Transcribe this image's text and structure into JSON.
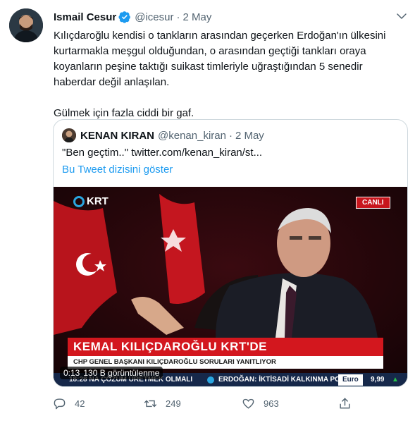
{
  "tweet": {
    "author_name": "Ismail Cesur",
    "author_handle": "@icesur",
    "separator": "·",
    "date": "2 May",
    "text_paragraph_1": "Kılıçdaroğlu kendisi o tankların arasından geçerken Erdoğan'ın ülkesini kurtarmakla meşgul olduğundan, o arasından geçtiği tankları oraya koyanların peşine taktığı suikast timleriyle uğraştığından 5 senedir haberdar değil anlaşılan.",
    "text_paragraph_2": "Gülmek için fazla ciddi bir gaf."
  },
  "quoted_tweet": {
    "author_name": "KENAN KIRAN",
    "author_handle": "@kenan_kiran",
    "separator": "·",
    "date": "2 May",
    "text": "\"Ben geçtim..\"  twitter.com/kenan_kiran/st...",
    "thread_link": "Bu Tweet dizisini göster",
    "video": {
      "channel_logo": "KRT",
      "live_badge": "CANLI",
      "lower_third_title": "KEMAL KILIÇDAROĞLU KRT'DE",
      "lower_third_subtitle": "CHP GENEL BAŞKANI KILIÇDAROĞLU SORULARI YANITLIYOR",
      "ticker_left": "18:28 NA ÇÖZÜM ÜRETMEK OLMALI",
      "ticker_right": "ERDOĞAN: İKTİSADİ KALKINMA PC",
      "ticker_euro_label": "Euro",
      "ticker_euro_value": "9,99",
      "ticker_euro_arrow": "▲",
      "elapsed_time": "0:13",
      "views": "130 B görüntülenme"
    }
  },
  "actions": {
    "reply_count": "42",
    "retweet_count": "249",
    "like_count": "963"
  },
  "icons": {
    "verified": "verified-badge-icon",
    "caret": "chevron-down-icon",
    "reply": "reply-icon",
    "retweet": "retweet-icon",
    "like": "heart-icon",
    "share": "share-icon"
  },
  "colors": {
    "link_blue": "#1d9bf0",
    "muted": "#536471",
    "border": "#cfd9de",
    "krt_red": "#d3171e",
    "ticker_navy": "#16284a"
  }
}
